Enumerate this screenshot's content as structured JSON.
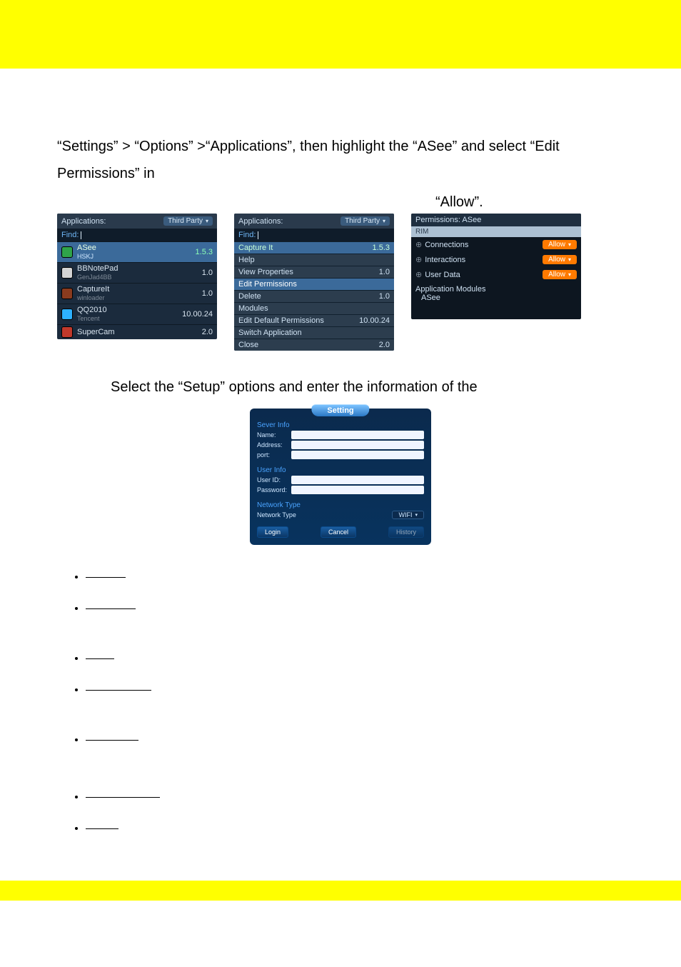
{
  "doc": {
    "para1": "“Settings” > “Options” >“Applications”, then highlight the “ASee” and select “Edit Permissions” in",
    "right_label": "“Allow”.",
    "center_line": "Select the “Setup” options and enter the information of the"
  },
  "panelA": {
    "title": "Applications:",
    "filter_label": "Third Party",
    "find_label": "Find:",
    "rows": [
      {
        "name": "ASee",
        "sub": "HSKJ",
        "ver": "1.5.3",
        "sel": true,
        "ico": "#2fa34a"
      },
      {
        "name": "BBNotePad",
        "sub": "GenJad4BB",
        "ver": "1.0",
        "sel": false,
        "ico": "#d4d4d4"
      },
      {
        "name": "CaptureIt",
        "sub": "winloader",
        "ver": "1.0",
        "sel": false,
        "ico": "#8a3b1e"
      },
      {
        "name": "QQ2010",
        "sub": "Tencent",
        "ver": "10.00.24",
        "sel": false,
        "ico": "#2db1ff"
      },
      {
        "name": "SuperCam",
        "sub": "",
        "ver": "2.0",
        "sel": false,
        "ico": "#c0392b"
      }
    ]
  },
  "panelB": {
    "title": "Applications:",
    "filter_label": "Third Party",
    "find_label": "Find:",
    "rows": [
      {
        "label": "Capture It",
        "ver": "1.5.3",
        "kind": "sel"
      },
      {
        "label": "Help",
        "ver": "",
        "kind": "plain"
      },
      {
        "label": "View Properties",
        "ver": "1.0",
        "kind": "plain"
      },
      {
        "label": "Edit Permissions",
        "ver": "",
        "kind": "hi"
      },
      {
        "label": "Delete",
        "ver": "1.0",
        "kind": "plain"
      },
      {
        "label": "Modules",
        "ver": "",
        "kind": "plain"
      },
      {
        "label": "Edit Default Permissions",
        "ver": "10.00.24",
        "kind": "plain"
      },
      {
        "label": "Switch Application",
        "ver": "",
        "kind": "plain"
      },
      {
        "label": "Close",
        "ver": "2.0",
        "kind": "plain"
      }
    ]
  },
  "panelC": {
    "title": "Permissions: ASee",
    "rim": "RIM",
    "perms": [
      {
        "label": "Connections",
        "btn": "Allow"
      },
      {
        "label": "Interactions",
        "btn": "Allow"
      },
      {
        "label": "User Data",
        "btn": "Allow"
      }
    ],
    "mods_label": "Application Modules",
    "mods_value": "ASee"
  },
  "setting": {
    "tab": "Setting",
    "sec1": "Sever Info",
    "fields1": [
      {
        "label": "Name:"
      },
      {
        "label": "Address:"
      },
      {
        "label": "port:"
      }
    ],
    "sec2": "User Info",
    "fields2": [
      {
        "label": "User ID:"
      },
      {
        "label": "Password:"
      }
    ],
    "sec3": "Network Type",
    "net_label": "Network Type",
    "net_value": "WIFI",
    "btns": [
      "Login",
      "Cancel",
      "History"
    ]
  },
  "bullets": {
    "widths": [
      56,
      70,
      40,
      92,
      74,
      104,
      46
    ]
  }
}
